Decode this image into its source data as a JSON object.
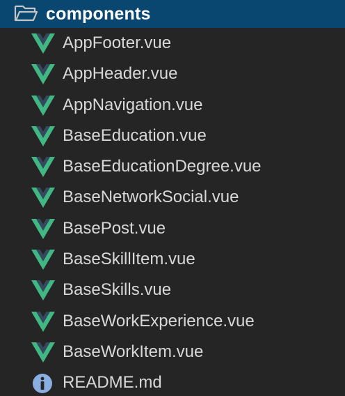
{
  "folder": {
    "name": "components",
    "icon": "folder-open-icon",
    "selected_bg": "#094771"
  },
  "files": [
    {
      "name": "AppFooter.vue",
      "icon": "vue-icon"
    },
    {
      "name": "AppHeader.vue",
      "icon": "vue-icon"
    },
    {
      "name": "AppNavigation.vue",
      "icon": "vue-icon"
    },
    {
      "name": "BaseEducation.vue",
      "icon": "vue-icon"
    },
    {
      "name": "BaseEducationDegree.vue",
      "icon": "vue-icon"
    },
    {
      "name": "BaseNetworkSocial.vue",
      "icon": "vue-icon"
    },
    {
      "name": "BasePost.vue",
      "icon": "vue-icon"
    },
    {
      "name": "BaseSkillItem.vue",
      "icon": "vue-icon"
    },
    {
      "name": "BaseSkills.vue",
      "icon": "vue-icon"
    },
    {
      "name": "BaseWorkExperience.vue",
      "icon": "vue-icon"
    },
    {
      "name": "BaseWorkItem.vue",
      "icon": "vue-icon"
    },
    {
      "name": "README.md",
      "icon": "info-icon"
    }
  ],
  "colors": {
    "vue_green": "#41b883",
    "vue_dark": "#34495e",
    "info_blue": "#8aaee0"
  }
}
